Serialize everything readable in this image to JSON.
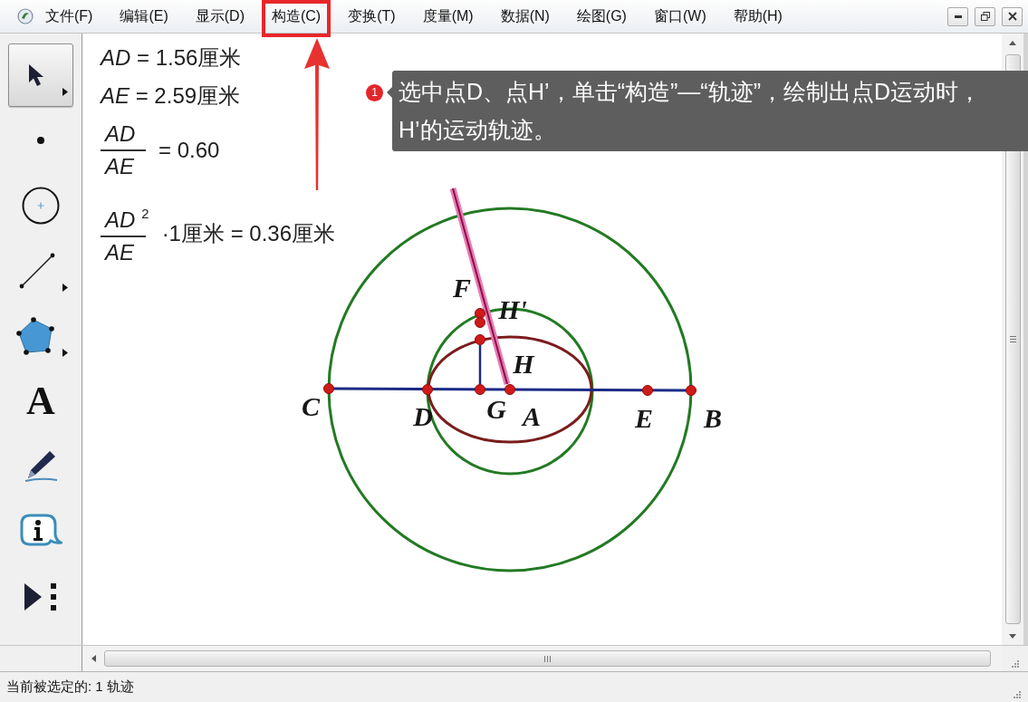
{
  "menu_bar": {
    "items": [
      {
        "label": "文件(F)",
        "highlighted": false
      },
      {
        "label": "编辑(E)",
        "highlighted": false
      },
      {
        "label": "显示(D)",
        "highlighted": false
      },
      {
        "label": "构造(C)",
        "highlighted": true
      },
      {
        "label": "变换(T)",
        "highlighted": false
      },
      {
        "label": "度量(M)",
        "highlighted": false
      },
      {
        "label": "数据(N)",
        "highlighted": false
      },
      {
        "label": "绘图(G)",
        "highlighted": false
      },
      {
        "label": "窗口(W)",
        "highlighted": false
      },
      {
        "label": "帮助(H)",
        "highlighted": false
      }
    ]
  },
  "toolbox": [
    {
      "kind": "arrow",
      "selected": true,
      "submenu": true
    },
    {
      "kind": "point",
      "selected": false,
      "submenu": false
    },
    {
      "kind": "compass",
      "selected": false,
      "submenu": false
    },
    {
      "kind": "straightedge",
      "selected": false,
      "submenu": true
    },
    {
      "kind": "polygon",
      "selected": false,
      "submenu": true
    },
    {
      "kind": "text",
      "label": "A",
      "selected": false,
      "submenu": false
    },
    {
      "kind": "marker",
      "selected": false,
      "submenu": false
    },
    {
      "kind": "information",
      "selected": false,
      "submenu": false
    },
    {
      "kind": "custom",
      "selected": false,
      "submenu": false
    }
  ],
  "measurements": [
    {
      "kind": "plain",
      "text": "*AD* = 1.56厘米"
    },
    {
      "kind": "plain",
      "text": "*AE* = 2.59厘米"
    },
    {
      "kind": "fraction",
      "numerator": "AD",
      "denominator": "AE",
      "result": "= 0.60"
    },
    {
      "kind": "fraction",
      "numerator": "AD$^{2}$",
      "denominator": "AE",
      "result": "·1厘米 = 0.36厘米"
    }
  ],
  "figure": {
    "point_labels": [
      "F",
      "H'",
      "H",
      "C",
      "D",
      "G",
      "A",
      "E",
      "B"
    ]
  },
  "callout": {
    "step": "1",
    "text": "选中点D、点H’，单击“构造”—“轨迹”，绘制出点D运动时，H’的运动轨迹。"
  },
  "status_bar": {
    "text": "当前被选定的: 1 轨迹"
  }
}
